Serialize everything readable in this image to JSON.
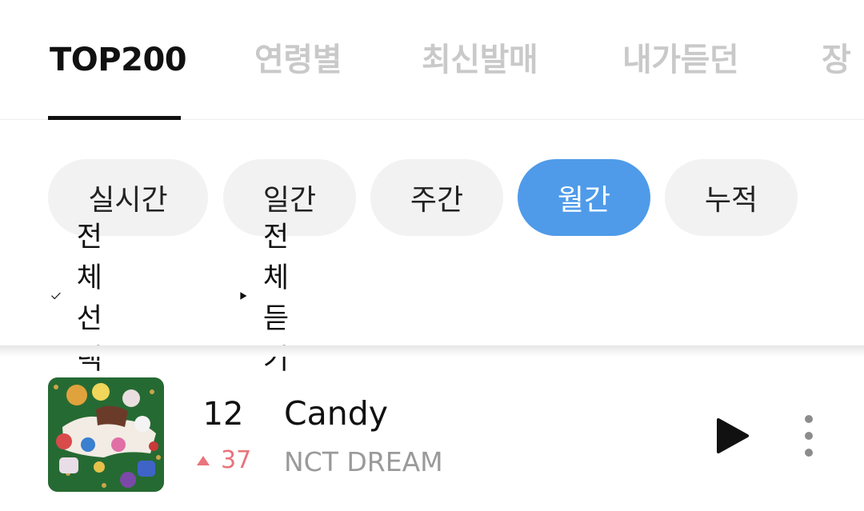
{
  "top_tabs": [
    "TOP200",
    "연령별",
    "최신발매",
    "내가듣던",
    "장"
  ],
  "period_chips": [
    "실시간",
    "일간",
    "주간",
    "월간",
    "누적"
  ],
  "active_period": "월간",
  "actions": {
    "select_all": "전체선택",
    "play_all": "전체듣기"
  },
  "song": {
    "rank": "12",
    "change": "37",
    "change_direction": "up",
    "title": "Candy",
    "artist": "NCT DREAM"
  },
  "icons": {
    "select_all": "checkmark-icon",
    "play_all": "play-icon",
    "rank_change": "triangle-up-icon",
    "song_play": "play-icon",
    "song_more": "more-vertical-icon"
  },
  "colors": {
    "accent": "#4f9be9",
    "rank_up": "#e8737b",
    "inactive_tab": "#c9c9c9"
  }
}
